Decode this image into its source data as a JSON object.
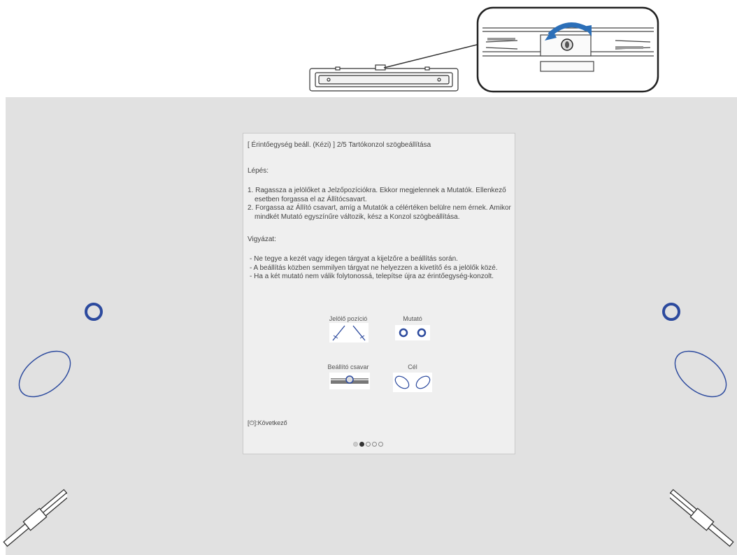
{
  "dialog": {
    "title": "[ Érintőegység beáll. (Kézi) ]  2/5 Tartókonzol szögbeállítása",
    "step_heading": "Lépés:",
    "steps": [
      "1. Ragassza a jelölőket a Jelzőpozíciókra. Ekkor megjelennek a Mutatók. Ellenkező esetben forgassa el az Állítócsavart.",
      "2. Forgassa az Állító csavart, amíg a Mutatók a célértéken belülre nem érnek. Amikor mindkét Mutató egyszínűre változik, kész a Konzol szögbeállítása."
    ],
    "caution_heading": "Vigyázat:",
    "cautions": [
      "- Ne tegye a kezét vagy idegen tárgyat a kijelzőre a beállítás során.",
      "- A beállítás közben semmilyen tárgyat ne helyezzen a kivetítő és a jelölők közé.",
      "- Ha a két mutató nem válik folytonossá, telepítse újra az érintőegység-konzolt."
    ],
    "legend": {
      "marker_position": "Jelölő pozíció",
      "indicator": "Mutató",
      "adjust_screw": "Beállító csavar",
      "target": "Cél"
    },
    "next_hint": "[⏻]:Következő",
    "pages": {
      "current": 2,
      "total": 5
    }
  },
  "colors": {
    "accent": "#2c4a9e",
    "screen_bg": "#e1e1e1",
    "dialog_bg": "#efefef"
  },
  "icons": {
    "illustration": "projector-screw-illustration",
    "pointers": "pen-marker-icon",
    "targets": "target-ellipse-icon",
    "indicators": "indicator-circle-icon"
  }
}
